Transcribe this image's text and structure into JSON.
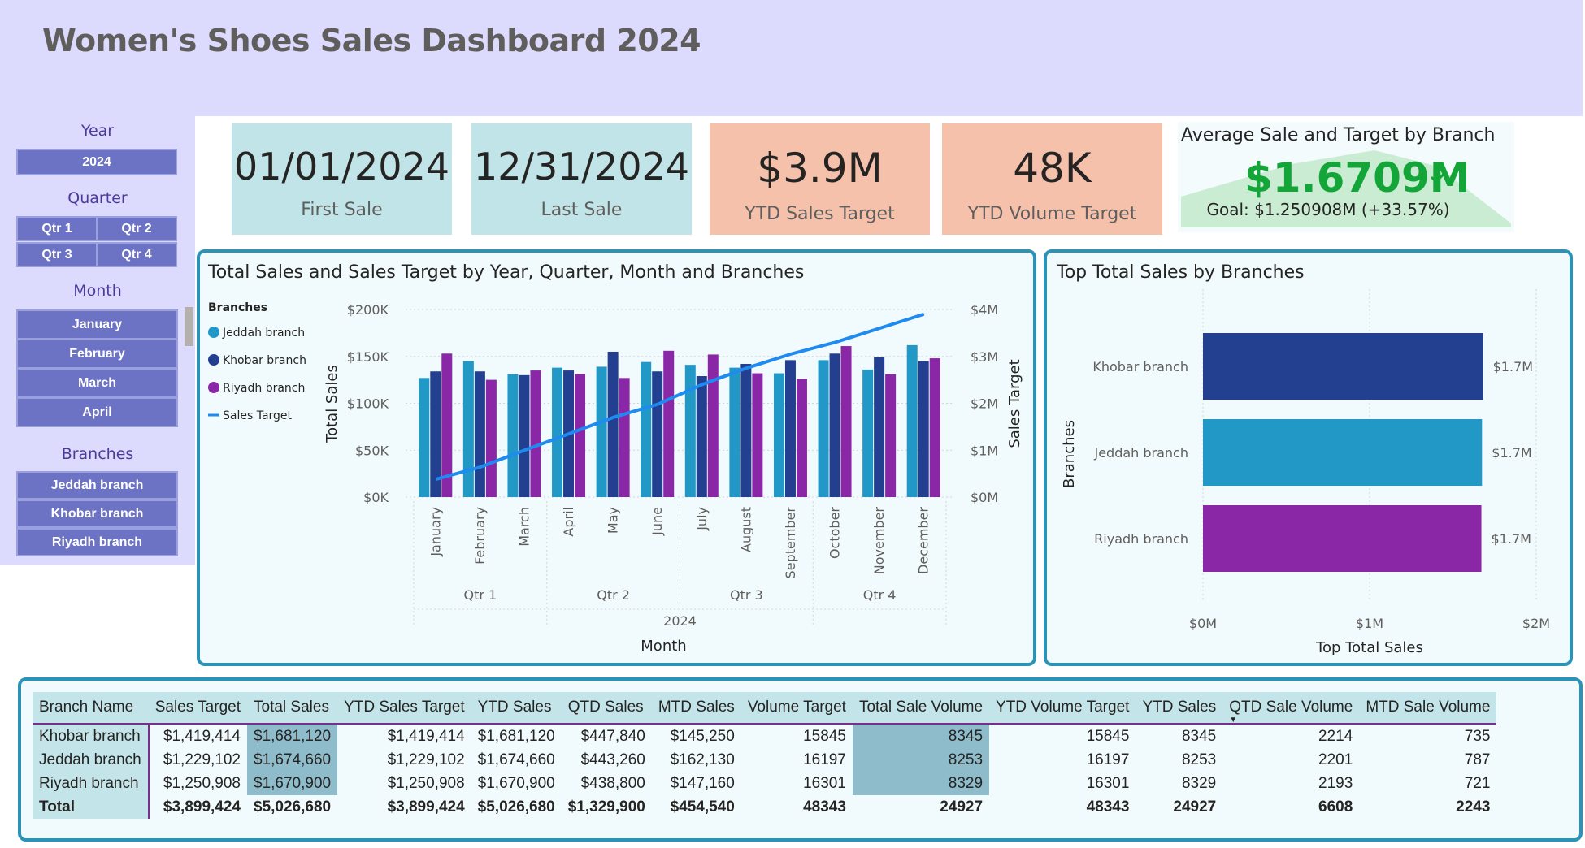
{
  "header": {
    "title": "Women's Shoes Sales Dashboard 2024"
  },
  "slicers": {
    "year": {
      "title": "Year",
      "selected": "2024"
    },
    "quarter": {
      "title": "Quarter",
      "items": [
        "Qtr 1",
        "Qtr 2",
        "Qtr 3",
        "Qtr 4"
      ]
    },
    "month": {
      "title": "Month",
      "items": [
        "January",
        "February",
        "March",
        "April"
      ]
    },
    "branches": {
      "title": "Branches",
      "items": [
        "Jeddah branch",
        "Khobar branch",
        "Riyadh branch"
      ]
    }
  },
  "cards": [
    {
      "value": "01/01/2024",
      "label": "First Sale"
    },
    {
      "value": "12/31/2024",
      "label": "Last Sale"
    },
    {
      "value": "$3.9M",
      "label": "YTD Sales Target"
    },
    {
      "value": "48K",
      "label": "YTD Volume Target"
    }
  ],
  "kpi": {
    "title": "Average Sale and Target by Branch",
    "value": "$1.6709M",
    "goal": "Goal: $1.250908M (+33.57%)"
  },
  "colors": {
    "jeddah": "#2298c6",
    "khobar": "#233f8f",
    "riyadh": "#8a27a6",
    "target_line": "#1f8af0",
    "kpi_green": "#13a538",
    "card_blue": "#c1e4e8",
    "card_salmon": "#f5c1ab"
  },
  "icons": {
    "kpi_status": "checkmark-icon"
  },
  "combo_chart": {
    "title": "Total Sales and Sales Target by Year, Quarter, Month and Branches",
    "legend_title": "Branches",
    "xlabel": "Month",
    "ylabel_left": "Total Sales",
    "ylabel_right": "Sales Target",
    "year_label": "2024",
    "left_ticks": [
      "$0K",
      "$50K",
      "$100K",
      "$150K",
      "$200K"
    ],
    "right_ticks": [
      "$0M",
      "$1M",
      "$2M",
      "$3M",
      "$4M"
    ]
  },
  "bar_chart": {
    "title": "Top Total Sales by Branches",
    "xlabel": "Top Total Sales",
    "ylabel": "Branches",
    "x_ticks": [
      "$0M",
      "$1M",
      "$2M"
    ]
  },
  "chart_data": [
    {
      "type": "bar",
      "title": "Total Sales and Sales Target by Year, Quarter, Month and Branches",
      "categories": [
        "January",
        "February",
        "March",
        "April",
        "May",
        "June",
        "July",
        "August",
        "September",
        "October",
        "November",
        "December"
      ],
      "quarters": [
        "Qtr 1",
        "Qtr 2",
        "Qtr 3",
        "Qtr 4"
      ],
      "ylim": [
        0,
        200000
      ],
      "y2lim": [
        0,
        4000000
      ],
      "series": [
        {
          "name": "Jeddah branch",
          "color": "#2298c6",
          "values": [
            127000,
            145000,
            131000,
            138000,
            139000,
            144000,
            141000,
            138000,
            132000,
            146000,
            136000,
            162000
          ]
        },
        {
          "name": "Khobar branch",
          "color": "#233f8f",
          "values": [
            134000,
            134000,
            130000,
            135000,
            155000,
            134000,
            129000,
            142000,
            146000,
            153000,
            149000,
            145000
          ]
        },
        {
          "name": "Riyadh branch",
          "color": "#8a27a6",
          "values": [
            153000,
            125000,
            135000,
            131000,
            127000,
            156000,
            152000,
            132000,
            126000,
            161000,
            131000,
            148000
          ]
        },
        {
          "name": "Sales Target",
          "type": "line",
          "axis": "right",
          "color": "#1f8af0",
          "values": [
            380000,
            640000,
            1000000,
            1350000,
            1700000,
            1980000,
            2400000,
            2750000,
            3050000,
            3300000,
            3600000,
            3900000
          ]
        }
      ],
      "xlabel": "Month",
      "ylabel": "Total Sales",
      "y2label": "Sales Target",
      "legend": "left"
    },
    {
      "type": "bar",
      "orientation": "horizontal",
      "title": "Top Total Sales by Branches",
      "categories": [
        "Khobar branch",
        "Jeddah branch",
        "Riyadh branch"
      ],
      "values": [
        1681120,
        1674660,
        1670900
      ],
      "data_labels": [
        "$1.7M",
        "$1.7M",
        "$1.7M"
      ],
      "colors": [
        "#233f8f",
        "#2298c6",
        "#8a27a6"
      ],
      "xlim": [
        0,
        2000000
      ],
      "xlabel": "Top Total Sales",
      "ylabel": "Branches"
    },
    {
      "type": "table",
      "columns": [
        "Branch Name",
        "Sales Target",
        "Total Sales",
        "YTD Sales Target",
        "YTD Sales",
        "QTD Sales",
        "MTD Sales",
        "Volume Target",
        "Total Sale Volume",
        "YTD Volume Target",
        "YTD Sales",
        "QTD Sale Volume",
        "MTD Sale Volume"
      ],
      "rows": [
        [
          "Khobar branch",
          "$1,419,414",
          "$1,681,120",
          "$1,419,414",
          "$1,681,120",
          "$447,840",
          "$145,250",
          "15845",
          "8345",
          "15845",
          "8345",
          "2214",
          "735"
        ],
        [
          "Jeddah branch",
          "$1,229,102",
          "$1,674,660",
          "$1,229,102",
          "$1,674,660",
          "$443,260",
          "$162,130",
          "16197",
          "8253",
          "16197",
          "8253",
          "2201",
          "787"
        ],
        [
          "Riyadh branch",
          "$1,250,908",
          "$1,670,900",
          "$1,250,908",
          "$1,670,900",
          "$438,800",
          "$147,160",
          "16301",
          "8329",
          "16301",
          "8329",
          "2193",
          "721"
        ]
      ],
      "total": [
        "Total",
        "$3,899,424",
        "$5,026,680",
        "$3,899,424",
        "$5,026,680",
        "$1,329,900",
        "$454,540",
        "48343",
        "24927",
        "48343",
        "24927",
        "6608",
        "2243"
      ]
    }
  ]
}
